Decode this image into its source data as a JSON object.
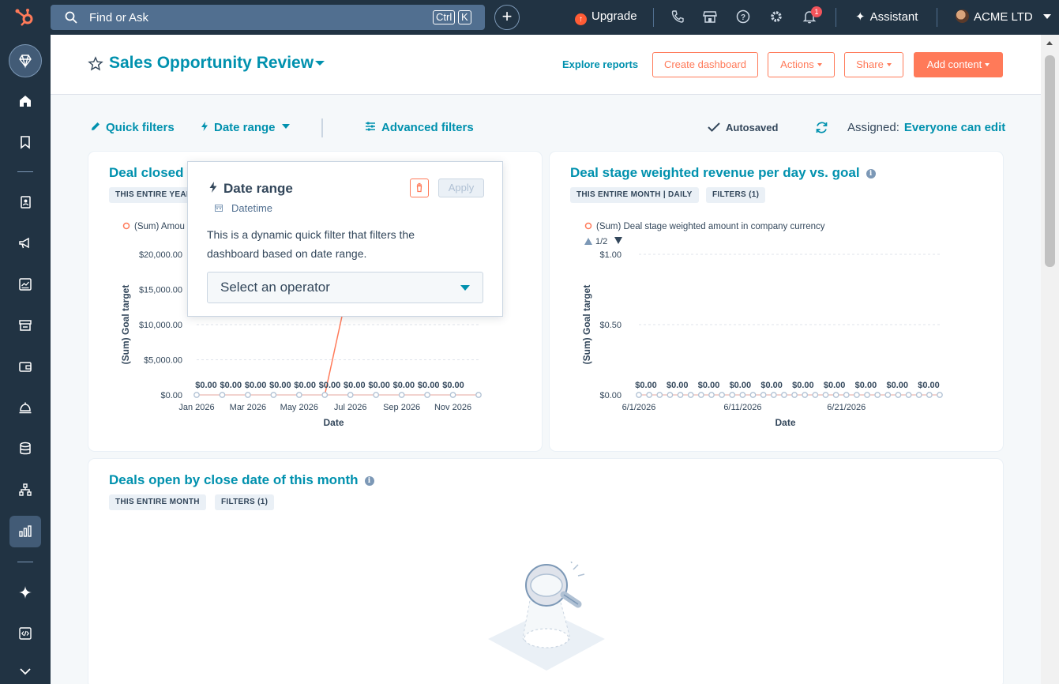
{
  "topbar": {
    "search_placeholder": "Find or Ask",
    "kbd_ctrl": "Ctrl",
    "kbd_k": "K",
    "upgrade_label": "Upgrade",
    "notification_count": "1",
    "assistant_label": "Assistant",
    "account_name": "ACME LTD"
  },
  "header": {
    "title": "Sales Opportunity Review",
    "explore_reports": "Explore reports",
    "create_dashboard": "Create dashboard",
    "actions": "Actions",
    "share": "Share",
    "add_content": "Add content"
  },
  "filter_bar": {
    "quick_filters": "Quick filters",
    "date_range": "Date range",
    "advanced_filters": "Advanced filters",
    "autosaved": "Autosaved",
    "assigned_label": "Assigned:",
    "assigned_value": "Everyone can edit"
  },
  "popover": {
    "title": "Date range",
    "subtitle": "Datetime",
    "apply": "Apply",
    "description": "This is a dynamic quick filter that filters the dashboard based on date range.",
    "select_placeholder": "Select an operator"
  },
  "cards": {
    "card1": {
      "title": "Deal closed t",
      "tag1": "THIS ENTIRE YEAR",
      "legend": "(Sum) Amou"
    },
    "card2": {
      "title": "Deal stage weighted revenue per day vs. goal",
      "tag1": "THIS ENTIRE MONTH | DAILY",
      "tag2": "FILTERS (1)",
      "legend": "(Sum) Deal stage weighted amount in company currency",
      "pager": "1/2"
    },
    "card3": {
      "title": "Deals open by close date of this month",
      "tag1": "THIS ENTIRE MONTH",
      "tag2": "FILTERS (1)"
    }
  },
  "chart_data": [
    {
      "type": "line",
      "xlabel": "Date",
      "ylabel": "(Sum) Goal target",
      "y_ticks": [
        "$20,000.00",
        "$15,000.00",
        "$10,000.00",
        "$5,000.00",
        "$0.00"
      ],
      "ylim": [
        0,
        20000
      ],
      "x_tick_labels": [
        "Jan 2026",
        "Mar 2026",
        "May 2026",
        "Jul 2026",
        "Sep 2026",
        "Nov 2026"
      ],
      "categories": [
        "Jan 2026",
        "Feb 2026",
        "Mar 2026",
        "Apr 2026",
        "May 2026",
        "Jun 2026",
        "Jul 2026",
        "Aug 2026",
        "Sep 2026",
        "Oct 2026",
        "Nov 2026",
        "Dec 2026"
      ],
      "data_labels": [
        "$0.00",
        "$0.00",
        "$0.00",
        "$0.00",
        "$0.00",
        "$0.00",
        "$0.00",
        "$0.00",
        "$0.00",
        "$0.00",
        "$0.00"
      ],
      "series": [
        {
          "name": "(Sum) Amou",
          "values": [
            0,
            0,
            0,
            0,
            0,
            0,
            0,
            0,
            0,
            0,
            0,
            0
          ]
        }
      ],
      "grid": true
    },
    {
      "type": "line",
      "xlabel": "Date",
      "ylabel": "(Sum) Goal target",
      "y_ticks": [
        "$1.00",
        "$0.50",
        "$0.00"
      ],
      "ylim": [
        0,
        1
      ],
      "x_tick_labels": [
        "6/1/2026",
        "6/11/2026",
        "6/21/2026"
      ],
      "point_count": 30,
      "data_labels": [
        "$0.00",
        "$0.00",
        "$0.00",
        "$0.00",
        "$0.00",
        "$0.00",
        "$0.00",
        "$0.00",
        "$0.00",
        "$0.00"
      ],
      "series": [
        {
          "name": "(Sum) Deal stage weighted amount in company currency",
          "values": [
            0,
            0,
            0,
            0,
            0,
            0,
            0,
            0,
            0,
            0,
            0,
            0,
            0,
            0,
            0,
            0,
            0,
            0,
            0,
            0,
            0,
            0,
            0,
            0,
            0,
            0,
            0,
            0,
            0,
            0
          ]
        }
      ],
      "grid": true
    }
  ]
}
